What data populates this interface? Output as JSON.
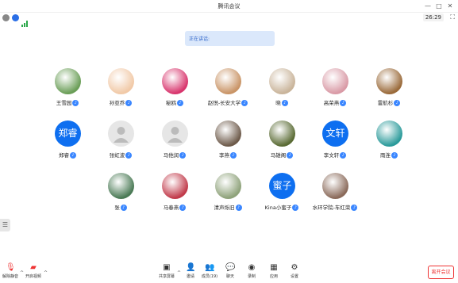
{
  "window": {
    "title": "腾讯会议"
  },
  "status": {
    "timer": "26:29"
  },
  "speaking": {
    "label": "正在讲话:"
  },
  "participants": [
    {
      "name": "王雪园",
      "avatar": "photo",
      "color": "#6a9e57"
    },
    {
      "name": "孙亚乔",
      "avatar": "photo",
      "color": "#f1c9a7"
    },
    {
      "name": "秘鸥",
      "avatar": "photo",
      "color": "#d8356d"
    },
    {
      "name": "赵悦-长安大学",
      "avatar": "photo",
      "color": "#c99466"
    },
    {
      "name": "晓",
      "avatar": "photo",
      "color": "#c9b49a"
    },
    {
      "name": "高荣燕",
      "avatar": "photo",
      "color": "#d99aa6"
    },
    {
      "name": "雷航杉",
      "avatar": "photo",
      "color": "#9a6a3a"
    },
    {
      "name": "郑睿",
      "avatar": "text",
      "initials": "郑睿"
    },
    {
      "name": "张虹波",
      "avatar": "gray"
    },
    {
      "name": "马他润",
      "avatar": "gray"
    },
    {
      "name": "李燕",
      "avatar": "photo",
      "color": "#6d5a4a"
    },
    {
      "name": "马雄阁",
      "avatar": "photo",
      "color": "#5a6b34"
    },
    {
      "name": "李文轩",
      "avatar": "text",
      "initials": "文轩"
    },
    {
      "name": "雨连",
      "avatar": "photo",
      "color": "#2a9a9a"
    },
    {
      "name": "张",
      "avatar": "photo",
      "color": "#4a7a55"
    },
    {
      "name": "马春燕",
      "avatar": "photo",
      "color": "#c13a4a"
    },
    {
      "name": "清声烁旧",
      "avatar": "photo",
      "color": "#8ea27a"
    },
    {
      "name": "Kina小蜜子",
      "avatar": "text",
      "initials": "蜜子"
    },
    {
      "name": "水环学院-车红荣",
      "avatar": "photo",
      "color": "#8a6a5a"
    }
  ],
  "toolbar": {
    "mute": "解除静音",
    "video": "开启视频",
    "share": "共享屏幕",
    "invite": "邀请",
    "members": "成员(19)",
    "chat": "聊天",
    "record": "录制",
    "apps": "应用",
    "settings": "设置",
    "leave": "离开会议"
  }
}
